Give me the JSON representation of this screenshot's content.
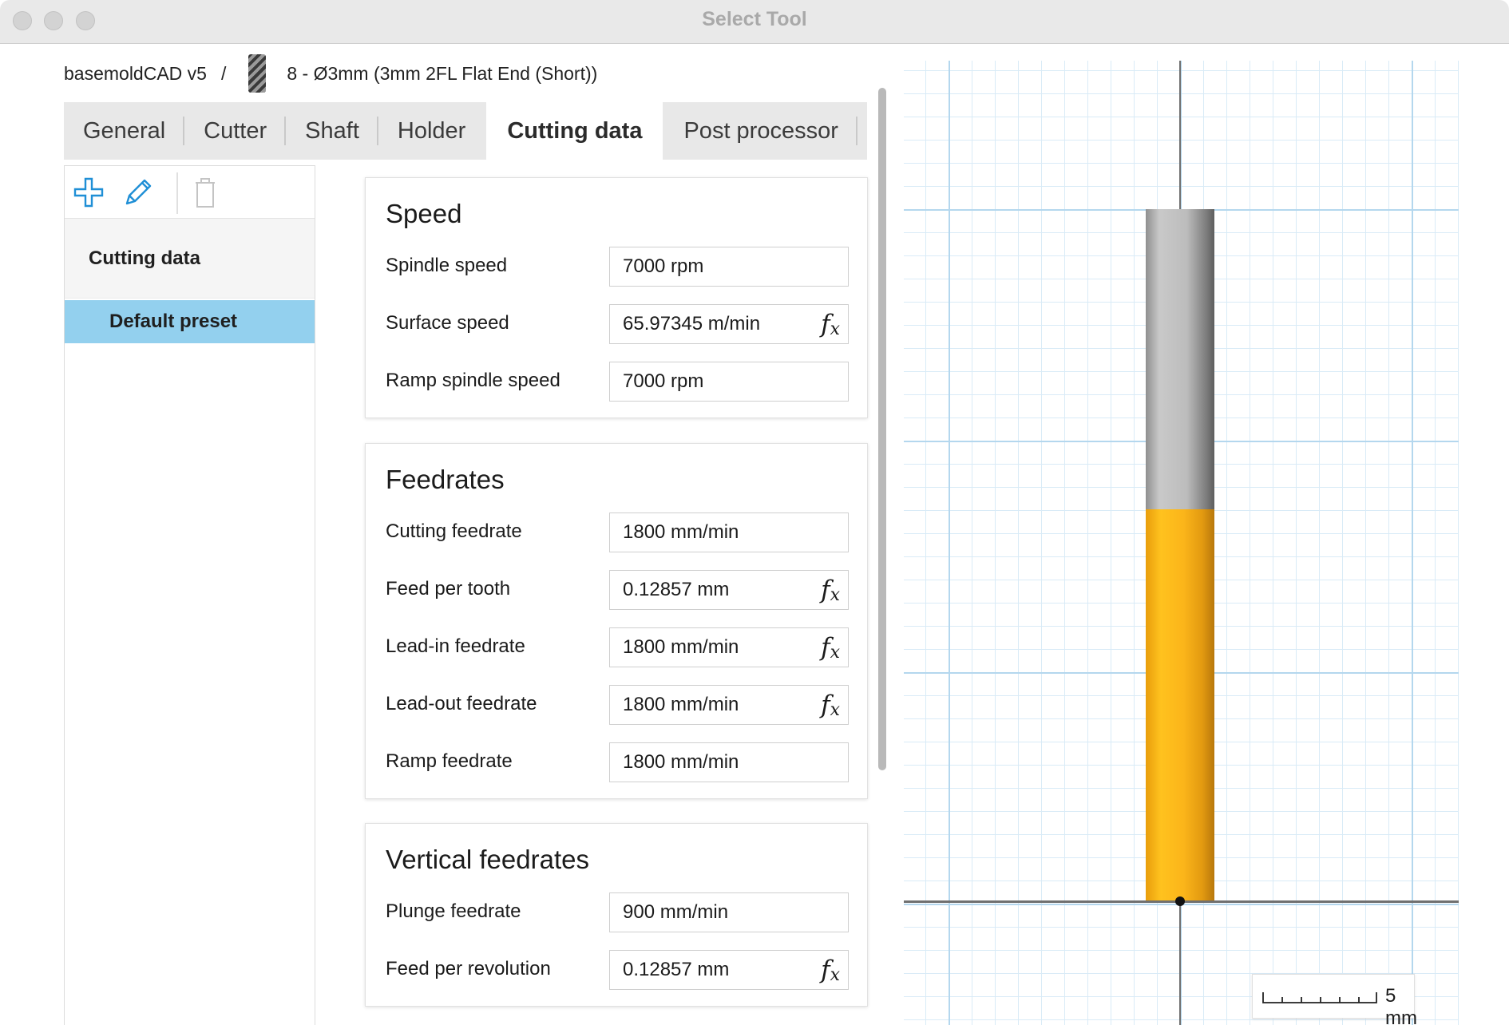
{
  "window": {
    "title": "Select Tool"
  },
  "breadcrumb": {
    "app": "basemoldCAD v5",
    "separator": "/",
    "tool": "8 - Ø3mm (3mm 2FL Flat End (Short))"
  },
  "tabs": [
    {
      "label": "General"
    },
    {
      "label": "Cutter"
    },
    {
      "label": "Shaft"
    },
    {
      "label": "Holder"
    },
    {
      "label": "Cutting data",
      "active": true
    },
    {
      "label": "Post processor"
    }
  ],
  "left_panel": {
    "toolbar": [
      "plus-icon",
      "pencil-icon",
      "trash-icon"
    ],
    "header": "Cutting data",
    "items": [
      {
        "label": "Default preset",
        "selected": true
      }
    ]
  },
  "fx_label": "f",
  "fx_sub": "x",
  "sections": {
    "speed": {
      "title": "Speed",
      "rows": [
        {
          "label": "Spindle speed",
          "value": "7000 rpm"
        },
        {
          "label": "Surface speed",
          "value": "65.97345 m/min",
          "fx": true
        },
        {
          "label": "Ramp spindle speed",
          "value": "7000 rpm"
        }
      ]
    },
    "feedrates": {
      "title": "Feedrates",
      "rows": [
        {
          "label": "Cutting feedrate",
          "value": "1800 mm/min"
        },
        {
          "label": "Feed per tooth",
          "value": "0.12857 mm",
          "fx": true
        },
        {
          "label": "Lead-in feedrate",
          "value": "1800 mm/min",
          "fx": true
        },
        {
          "label": "Lead-out feedrate",
          "value": "1800 mm/min",
          "fx": true
        },
        {
          "label": "Ramp feedrate",
          "value": "1800 mm/min"
        }
      ]
    },
    "vertical": {
      "title": "Vertical feedrates",
      "rows": [
        {
          "label": "Plunge feedrate",
          "value": "900 mm/min"
        },
        {
          "label": "Feed per revolution",
          "value": "0.12857 mm",
          "fx": true
        }
      ]
    }
  },
  "viewport": {
    "scale_label": "5 mm",
    "colors": {
      "cutter": "#fbb51a",
      "holder": "#bcbcbc",
      "grid": "#b4d7ee",
      "selection": "#93d0ee"
    }
  }
}
